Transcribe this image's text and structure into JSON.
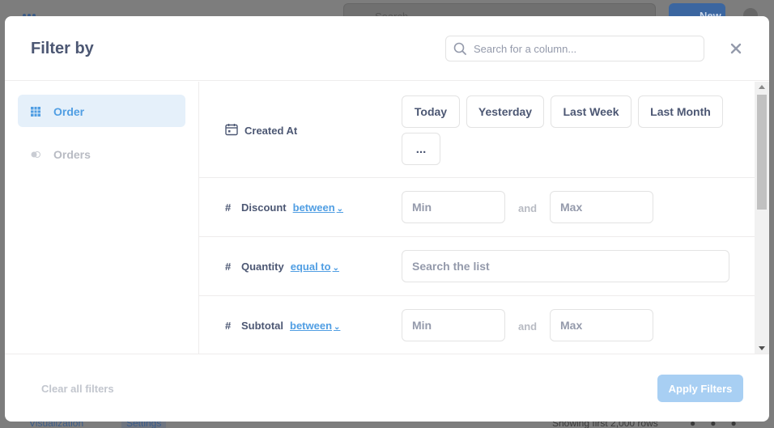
{
  "background_app": {
    "search_label": "Search",
    "new_button_label": "New",
    "visualization_label": "Visualization",
    "settings_label": "Settings",
    "rows_status": "Showing first 2,000 rows"
  },
  "modal": {
    "title": "Filter by",
    "search_placeholder": "Search for a column...",
    "close_icon": "close-icon"
  },
  "sidebar": {
    "items": [
      {
        "label": "Order",
        "icon": "table-grid-icon",
        "active": true
      },
      {
        "label": "Orders",
        "icon": "segment-toggle-icon",
        "active": false
      }
    ]
  },
  "filters": {
    "created_at": {
      "label": "Created At",
      "icon": "calendar-icon",
      "shortcuts": [
        "Today",
        "Yesterday",
        "Last Week",
        "Last Month"
      ],
      "more_label": "..."
    },
    "discount": {
      "label": "Discount",
      "operator": "between",
      "min_placeholder": "Min",
      "and_label": "and",
      "max_placeholder": "Max"
    },
    "quantity": {
      "label": "Quantity",
      "operator": "equal to",
      "search_placeholder": "Search the list"
    },
    "subtotal": {
      "label": "Subtotal",
      "operator": "between",
      "min_placeholder": "Min",
      "and_label": "and",
      "max_placeholder": "Max"
    },
    "number_icon": "#"
  },
  "footer": {
    "clear_label": "Clear all filters",
    "apply_label": "Apply Filters"
  },
  "colors": {
    "brand": "#509ee3",
    "brand_light": "#a8cff3",
    "text_dark": "#4c5773",
    "text_muted": "#b8bbc3",
    "border": "#e3e3e3"
  }
}
